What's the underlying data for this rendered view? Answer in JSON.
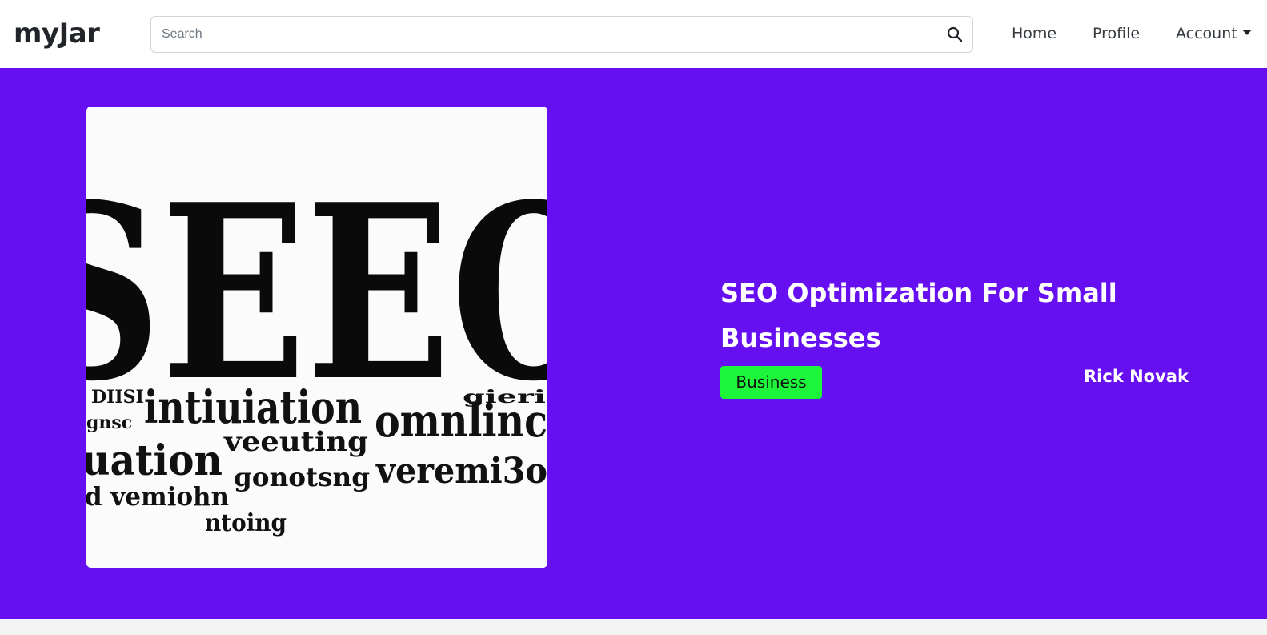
{
  "app": {
    "brand": "myJar"
  },
  "search": {
    "placeholder": "Search",
    "value": ""
  },
  "nav": {
    "home": "Home",
    "profile": "Profile",
    "account": "Account"
  },
  "post": {
    "title": "SEO Optimization For Small Businesses",
    "category": "Business",
    "author": "Rick Novak",
    "image_text": {
      "big": "SEEO",
      "words": [
        "DIISI",
        "intiuiation",
        "gnsc",
        "omnlinc",
        "uation",
        "veeuting",
        "d vemiohn",
        "ɡonotsng",
        "veremi3o",
        "ntoing",
        "gieri"
      ]
    }
  },
  "colors": {
    "hero_bg": "#6610f2",
    "badge_bg": "#1cf53a",
    "nav_text": "#343a40"
  },
  "icons": {
    "search": "search-icon",
    "caret": "caret-down-icon"
  }
}
